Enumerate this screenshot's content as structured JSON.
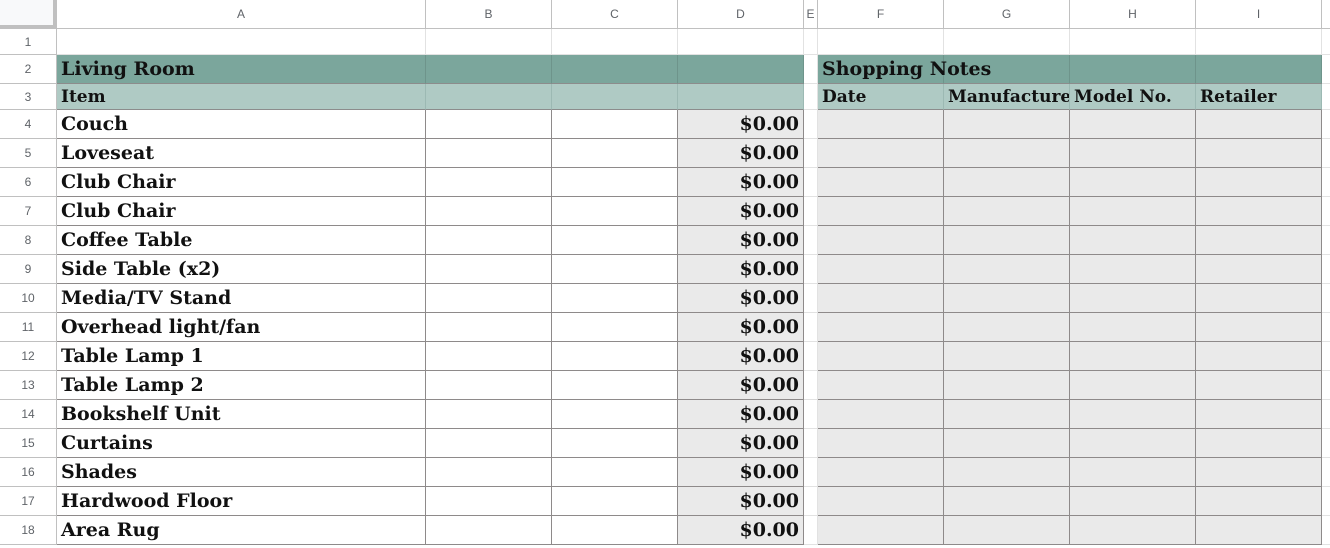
{
  "sheet": {
    "columns": [
      "A",
      "B",
      "C",
      "D",
      "E",
      "F",
      "G",
      "H",
      "I"
    ],
    "rows": [
      "1",
      "2",
      "3",
      "4",
      "5",
      "6",
      "7",
      "8",
      "9",
      "10",
      "11",
      "12",
      "13",
      "14",
      "15",
      "16",
      "17",
      "18"
    ]
  },
  "living_room": {
    "title": "Living Room",
    "header": "Item",
    "items": [
      {
        "name": "Couch",
        "price": "$0.00"
      },
      {
        "name": "Loveseat",
        "price": "$0.00"
      },
      {
        "name": "Club Chair",
        "price": "$0.00"
      },
      {
        "name": "Club Chair",
        "price": "$0.00"
      },
      {
        "name": "Coffee Table",
        "price": "$0.00"
      },
      {
        "name": "Side Table (x2)",
        "price": "$0.00"
      },
      {
        "name": "Media/TV Stand",
        "price": "$0.00"
      },
      {
        "name": "Overhead light/fan",
        "price": "$0.00"
      },
      {
        "name": "Table Lamp 1",
        "price": "$0.00"
      },
      {
        "name": "Table Lamp 2",
        "price": "$0.00"
      },
      {
        "name": "Bookshelf Unit",
        "price": "$0.00"
      },
      {
        "name": "Curtains",
        "price": "$0.00"
      },
      {
        "name": "Shades",
        "price": "$0.00"
      },
      {
        "name": "Hardwood Floor",
        "price": "$0.00"
      },
      {
        "name": "Area Rug",
        "price": "$0.00"
      }
    ]
  },
  "shopping_notes": {
    "title": "Shopping Notes",
    "headers": [
      "Date",
      "Manufacturer",
      "Model No.",
      "Retailer"
    ]
  },
  "colors": {
    "title_bg": "#7ba69c",
    "subheader_bg": "#afcac4",
    "input_bg": "#eaeaea"
  }
}
